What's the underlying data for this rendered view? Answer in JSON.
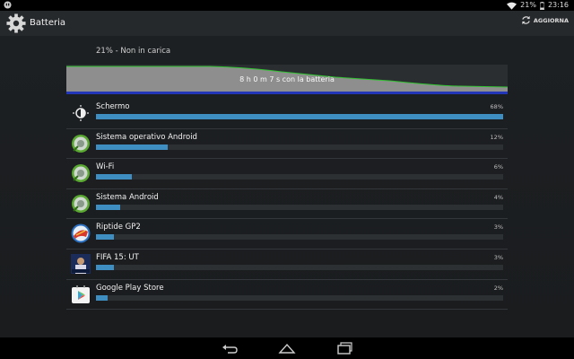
{
  "status_bar": {
    "battery": "21%",
    "time": "23:16"
  },
  "header": {
    "title": "Batteria",
    "refresh_label": "AGGIORNA"
  },
  "battery_status": "21% - Non in carica",
  "graph": {
    "label": "8 h 0 m 7 s con la batteria"
  },
  "usage": [
    {
      "name": "Schermo",
      "percent": "68%",
      "value": 68,
      "icon": "screen-brightness-icon"
    },
    {
      "name": "Sistema operativo Android",
      "percent": "12%",
      "value": 12,
      "icon": "android-system-icon"
    },
    {
      "name": "Wi-Fi",
      "percent": "6%",
      "value": 6,
      "icon": "wifi-icon"
    },
    {
      "name": "Sistema Android",
      "percent": "4%",
      "value": 4,
      "icon": "android-system-icon"
    },
    {
      "name": "Riptide GP2",
      "percent": "3%",
      "value": 3,
      "icon": "riptide-gp2-icon"
    },
    {
      "name": "FIFA 15: UT",
      "percent": "3%",
      "value": 3,
      "icon": "fifa15-icon"
    },
    {
      "name": "Google Play Store",
      "percent": "2%",
      "value": 2,
      "icon": "play-store-icon"
    }
  ],
  "colors": {
    "bar": "#3e8ec2",
    "graph_fill": "#8e8e8e",
    "graph_line": "#33c433",
    "graph_base": "#2336b8"
  }
}
